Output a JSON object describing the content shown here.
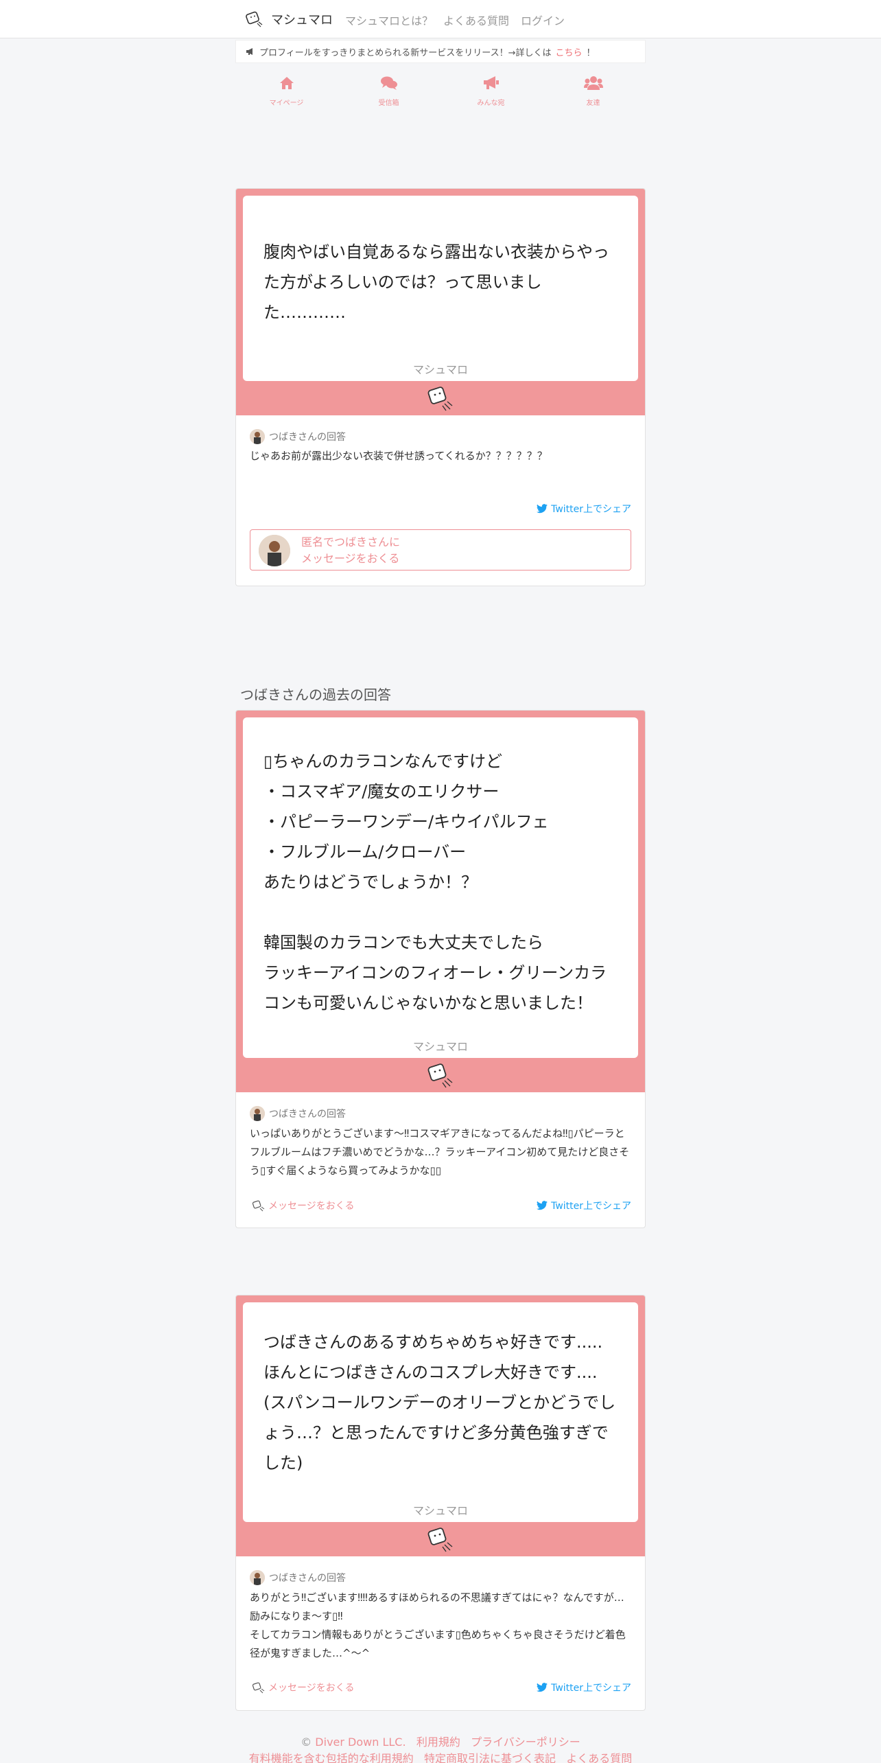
{
  "nav": {
    "brand": "マシュマロ",
    "links": [
      "マシュマロとは？",
      "よくある質問",
      "ログイン"
    ]
  },
  "announcement": {
    "text": "プロフィールをすっきりまとめられる新サービスをリリース！→詳しくは",
    "link": "こちら",
    "suffix": "！"
  },
  "tabs": [
    {
      "label": "マイページ",
      "icon": "home-icon"
    },
    {
      "label": "受信箱",
      "icon": "comments-icon"
    },
    {
      "label": "みんな宛",
      "icon": "bullhorn-icon"
    },
    {
      "label": "友達",
      "icon": "users-icon"
    }
  ],
  "brand_label": "マシュマロ",
  "main_card": {
    "message": "腹肉やばい自覚あるなら露出ない衣装からやった方がよろしいのでは？って思いました…………",
    "answer_label": "つばきさんの回答",
    "answer": "じゃあお前が露出少ない衣装で併せ誘ってくれるか？？？？？？",
    "share": "Twitter上でシェア",
    "anon_line1": "匿名でつばきさんに",
    "anon_line2": "メッセージをおくる"
  },
  "past_title": "つばきさんの過去の回答",
  "past": [
    {
      "message": "▯ちゃんのカラコンなんですけど\n・コスマギア/魔女のエリクサー\n・パピーラーワンデー/キウイパルフェ\n・フルブルーム/クローバー\nあたりはどうでしょうか！？\n\n韓国製のカラコンでも大丈夫でしたら\nラッキーアイコンのフィオーレ・グリーンカラコンも可愛いんじゃないかなと思いました！",
      "answer_label": "つばきさんの回答",
      "answer": "いっぱいありがとうございます〜‼コスマギアきになってるんだよね‼▯パピーラとフルブルームはフチ濃いめでどうかな…？ラッキーアイコン初めて見たけど良さそう▯すぐ届くようなら買ってみようかな▯▯",
      "send": "メッセージをおくる",
      "share": "Twitter上でシェア"
    },
    {
      "message": "つばきさんのあるすめちゃめちゃ好きです.....ほんとにつばきさんのコスプレ大好きです....\n(スパンコールワンデーのオリーブとかどうでしょう…？と思ったんですけど多分黄色強すぎでした)",
      "answer_label": "つばきさんの回答",
      "answer": "ありがとう‼ございます‼‼あるすほめられるの不思議すぎてはにゃ？なんですが…励みになりま〜す▯‼\nそしてカラコン情報もありがとうございます▯色めちゃくちゃ良さそうだけど着色径が鬼すぎました…^〜^",
      "send": "メッセージをおくる",
      "share": "Twitter上でシェア"
    }
  ],
  "footer": {
    "copy": "©",
    "line1": [
      "Diver Down LLC.",
      "利用規約",
      "プライバシーポリシー"
    ],
    "line2": [
      "有料機能を含む包括的な利用規約",
      "特定商取引法に基づく表記",
      "よくある質問"
    ]
  }
}
